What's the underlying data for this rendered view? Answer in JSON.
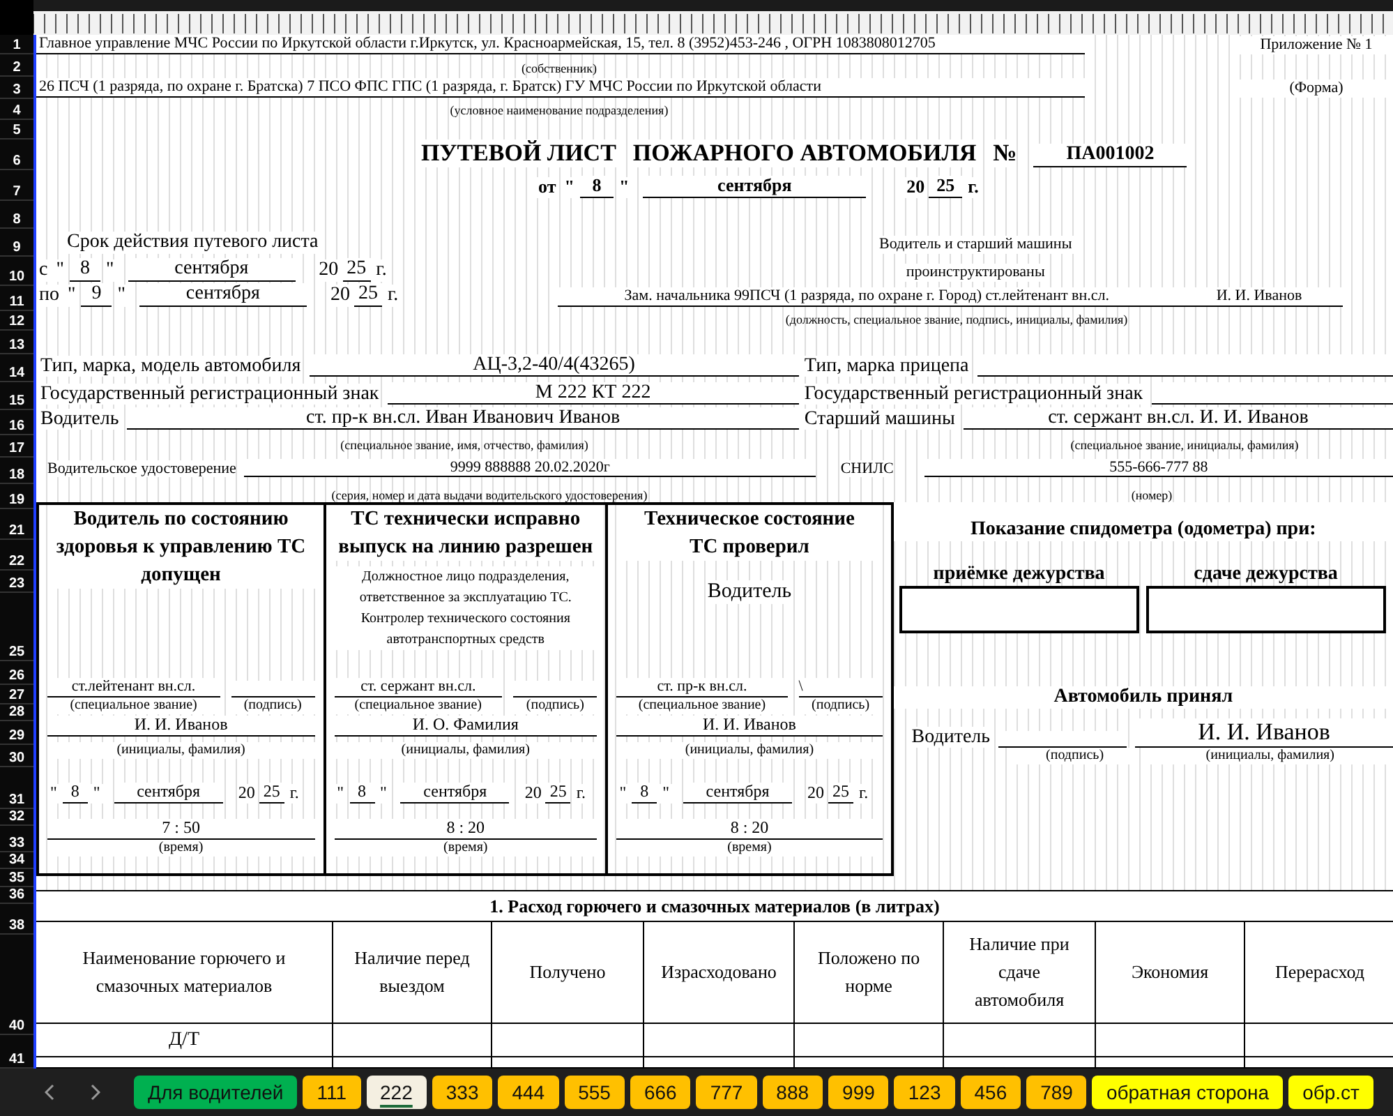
{
  "row_numbers": [
    "1",
    "2",
    "3",
    "4",
    "5",
    "6",
    "7",
    "8",
    "9",
    "10",
    "11",
    "12",
    "13",
    "14",
    "15",
    "16",
    "17",
    "18",
    "19",
    "21",
    "22",
    "23",
    "25",
    "26",
    "27",
    "28",
    "29",
    "30",
    "31",
    "32",
    "33",
    "34",
    "35",
    "36",
    "38",
    "40",
    "41"
  ],
  "header": {
    "owner": "Главное управление МЧС России по Иркутской области г.Иркутск, ул. Красноармейская, 15, тел. 8 (3952)453-246 , ОГРН 1083808012705",
    "owner_caption": "(собственник)",
    "appendix": "Приложение № 1",
    "unit": "26 ПСЧ (1 разряда, по охране г. Братска) 7 ПСО ФПС ГПС (1 разряда, г. Братск) ГУ МЧС России по Иркутской области",
    "unit_caption": "(условное наименование подразделения)",
    "form_label": "(Форма)"
  },
  "title": {
    "parts": [
      "ПУТЕВОЙ ЛИСТ",
      "ПОЖАРНОГО АВТОМОБИЛЯ"
    ],
    "number_sign": "№",
    "number": "ПА001002",
    "date": {
      "prefix": "от",
      "open": "\"",
      "day": "8",
      "close": "\"",
      "month": "сентября",
      "century": "20",
      "year": "25",
      "suffix": "г."
    }
  },
  "validity": {
    "title": "Срок действия путевого листа",
    "dates": [
      {
        "prefix": "с",
        "open": "\"",
        "day": "8",
        "close": "\"",
        "month": "сентября",
        "century": "20",
        "year": "25",
        "suffix": "г."
      },
      {
        "prefix": "по",
        "open": "\"",
        "day": "9",
        "close": "\"",
        "month": "сентября",
        "century": "20",
        "year": "25",
        "suffix": "г."
      }
    ]
  },
  "briefing": {
    "line1": "Водитель и старший машины",
    "line2": "проинструктированы",
    "position": "Зам. начальника 99ПСЧ (1 разряда, по охране г. Город) ст.лейтенант вн.сл.",
    "name": "И. И. Иванов",
    "caption": "(должность, специальное звание, подпись, инициалы, фамилия)"
  },
  "vehicle": {
    "left": [
      {
        "label": "Тип, марка, модель автомобиля",
        "value": "АЦ-3,2-40/4(43265)"
      },
      {
        "label": "Государственный регистрационный знак",
        "value": "М 222 КТ 222"
      },
      {
        "label": "Водитель",
        "value": "ст. пр-к вн.сл. Иван Иванович Иванов",
        "caption": "(специальное звание, имя, отчество, фамилия)"
      }
    ],
    "right": [
      {
        "label": "Тип, марка прицепа"
      },
      {
        "label": "Государственный регистрационный знак"
      },
      {
        "label": "Старший машины",
        "value": "ст. сержант вн.сл. И. И. Иванов",
        "caption": "(специальное звание, инициалы, фамилия)"
      }
    ],
    "license": {
      "label": "Водительское удостоверение",
      "value": "9999 888888 20.02.2020г",
      "caption": "(серия, номер и дата выдачи водительского удостоверения)"
    },
    "snils": {
      "label": "СНИЛС",
      "value": "555-666-777 88",
      "caption": "(номер)"
    }
  },
  "panels": [
    {
      "title": "Водитель по состоянию здоровья к управлению ТС допущен",
      "rank": "ст.лейтенант вн.сл.",
      "rank_caption": "(специальное звание)",
      "signature_caption": "(подпись)",
      "name": "И. И. Иванов",
      "name_caption": "(инициалы, фамилия)",
      "date": {
        "open": "\"",
        "day": "8",
        "close": "\"",
        "month": "сентября",
        "century": "20",
        "year": "25",
        "suffix": "г."
      },
      "time": "7 : 50",
      "time_caption": "(время)"
    },
    {
      "title": "ТС технически исправно выпуск на линию разрешен",
      "note": "Должностное лицо подразделения, ответственное за эксплуатацию ТС. Контролер технического состояния автотранспортных средств",
      "rank": "ст. сержант вн.сл.",
      "rank_caption": "(специальное звание)",
      "signature_caption": "(подпись)",
      "name": "И. О. Фамилия",
      "name_caption": "(инициалы, фамилия)",
      "date": {
        "open": "\"",
        "day": "8",
        "close": "\"",
        "month": "сентября",
        "century": "20",
        "year": "25",
        "suffix": "г."
      },
      "time": "8 : 20",
      "time_caption": "(время)"
    },
    {
      "title": "Техническое состояние ТС проверил",
      "role": "Водитель",
      "rank": "ст. пр-к вн.сл.",
      "rank_caption": "(специальное звание)",
      "signature": "\\",
      "signature_caption": "(подпись)",
      "name": "И. И. Иванов",
      "name_caption": "(инициалы, фамилия)",
      "date": {
        "open": "\"",
        "day": "8",
        "close": "\"",
        "month": "сентября",
        "century": "20",
        "year": "25",
        "suffix": "г."
      },
      "time": "8 : 20",
      "time_caption": "(время)"
    }
  ],
  "odometer": {
    "title": "Показание спидометра (одометра) при:",
    "columns": [
      "приёмке дежурства",
      "сдаче дежурства"
    ]
  },
  "accepted": {
    "title": "Автомобиль принял",
    "role": "Водитель",
    "name": "И. И. Иванов",
    "signature_caption": "(подпись)",
    "name_caption": "(инициалы, фамилия)"
  },
  "fuel": {
    "title": "1. Расход горючего и смазочных материалов (в литрах)",
    "columns": [
      "Наименование горючего и смазочных материалов",
      "Наличие перед выездом",
      "Получено",
      "Израсходовано",
      "Положено по норме",
      "Наличие при сдаче автомобиля",
      "Экономия",
      "Перерасход"
    ],
    "rows": [
      {
        "name": "Д/Т"
      }
    ]
  },
  "tabs": [
    {
      "label": "Для водителей",
      "color": "#00b050",
      "selected": false
    },
    {
      "label": "111",
      "color": "#ffc000",
      "selected": false
    },
    {
      "label": "222",
      "selected": true
    },
    {
      "label": "333",
      "color": "#ffc000",
      "selected": false
    },
    {
      "label": "444",
      "color": "#ffc000",
      "selected": false
    },
    {
      "label": "555",
      "color": "#ffc000",
      "selected": false
    },
    {
      "label": "666",
      "color": "#ffc000",
      "selected": false
    },
    {
      "label": "777",
      "color": "#ffc000",
      "selected": false
    },
    {
      "label": "888",
      "color": "#ffc000",
      "selected": false
    },
    {
      "label": "999",
      "color": "#ffc000",
      "selected": false
    },
    {
      "label": "123",
      "color": "#ffc000",
      "selected": false
    },
    {
      "label": "456",
      "color": "#ffc000",
      "selected": false
    },
    {
      "label": "789",
      "color": "#ffc000",
      "selected": false
    },
    {
      "label": "обратная сторона",
      "color": "#ffff00",
      "selected": false
    },
    {
      "label": "обр.ст",
      "color": "#ffff00",
      "selected": false
    }
  ]
}
